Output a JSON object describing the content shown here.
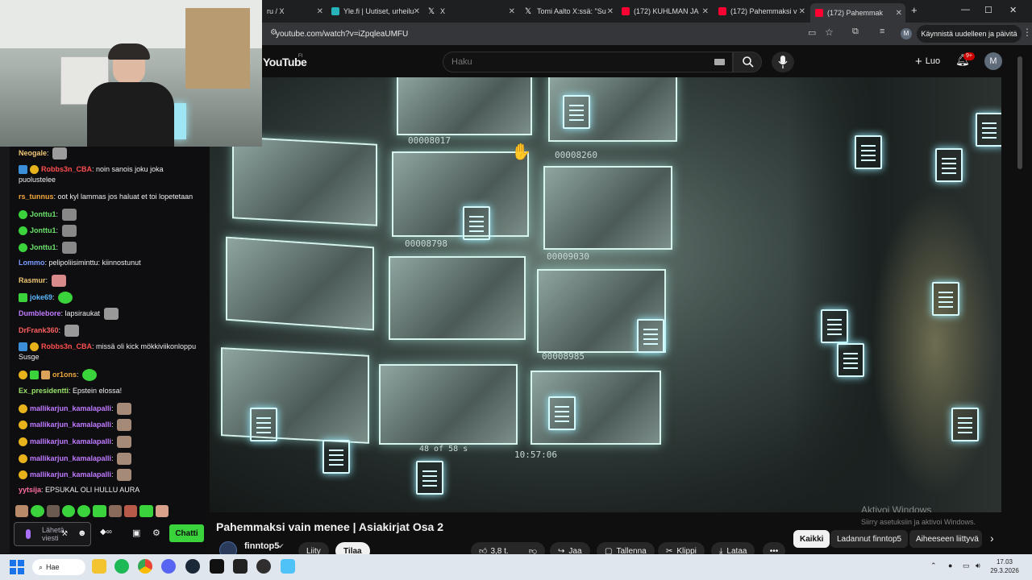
{
  "browser": {
    "tabs": [
      {
        "label": "ru / X",
        "favicon": "x-icon"
      },
      {
        "label": "Yle.fi | Uutiset, urheilu",
        "favicon": "yle-icon"
      },
      {
        "label": "X",
        "favicon": "x-icon"
      },
      {
        "label": "Tomi Aalto X:ssä: \"Su",
        "favicon": "x-icon"
      },
      {
        "label": "(172) KUHLMAN JA",
        "favicon": "youtube-icon"
      },
      {
        "label": "(172) Pahemmaksi v",
        "favicon": "youtube-icon"
      },
      {
        "label": "(172) Pahemmak",
        "favicon": "youtube-icon"
      }
    ],
    "url": "youtube.com/watch?v=iZpqleaUMFU",
    "restart_label": "Käynnistä uudelleen ja päivitä",
    "profile_initial": "M"
  },
  "youtube": {
    "logo": "YouTube",
    "region": "FI",
    "search_placeholder": "Haku",
    "create_label": "Luo",
    "notifications_badge": "9+",
    "avatar_initial": "M",
    "video_title": "Pahemmaksi vain menee | Asiakirjat Osa 2",
    "channel_name": "finntop5",
    "join_label": "Liity",
    "subscribe_label": "Tilaa",
    "like_count": "3,8 t.",
    "share_label": "Jaa",
    "save_label": "Tallenna",
    "clip_label": "Klippi",
    "download_label": "Lataa",
    "chips": [
      "Kaikki",
      "Ladannut finntop5",
      "Aiheeseen liittyvä"
    ],
    "video_text": {
      "codes": [
        "00008017",
        "00008260",
        "00008798",
        "00009030",
        "00008985"
      ],
      "counter": "48 of 58 s",
      "timestamp": "10:57:06"
    },
    "windows_watermark_title": "Aktivoi Windows",
    "windows_watermark_sub": "Siirry asetuksiin ja aktivoi Windows."
  },
  "chat": {
    "messages": [
      {
        "user": "Neogale",
        "text": "",
        "color": "#f0c674"
      },
      {
        "user": "Robbs3n_CBA",
        "text": "noin sanois joku joka puolustelee",
        "color": "#ff4f4f"
      },
      {
        "user": "rs_tunnus",
        "text": "oot kyl lammas jos haluat et toi lopetetaan",
        "color": "#f2a93b"
      },
      {
        "user": "Jonttu1",
        "text": "",
        "color": "#6ae36a"
      },
      {
        "user": "Jonttu1",
        "text": "",
        "color": "#6ae36a"
      },
      {
        "user": "Jonttu1",
        "text": "",
        "color": "#6ae36a"
      },
      {
        "user": "Lommo",
        "text": "pelipoliisiminttu: kiinnostunut",
        "color": "#7a9cff"
      },
      {
        "user": "Rasmur",
        "text": "",
        "color": "#f0c674"
      },
      {
        "user": "joke69",
        "text": "",
        "color": "#5ab7ff"
      },
      {
        "user": "Dumblebore",
        "text": "lapsiraukat",
        "color": "#c07aff"
      },
      {
        "user": "DrFrank360",
        "text": "",
        "color": "#ff5f5f"
      },
      {
        "user": "Robbs3n_CBA",
        "text": "missä oli kick mökkiviikonloppu Susge",
        "color": "#ff4f4f"
      },
      {
        "user": "or1ons",
        "text": "",
        "color": "#f2a93b"
      },
      {
        "user": "Ex_presidentti",
        "text": "Epstein elossa!",
        "color": "#9be36a"
      },
      {
        "user": "mallikarjun_kamalapalli",
        "text": "",
        "color": "#c07aff"
      },
      {
        "user": "mallikarjun_kamalapalli",
        "text": "",
        "color": "#c07aff"
      },
      {
        "user": "mallikarjun_kamalapalli",
        "text": "",
        "color": "#c07aff"
      },
      {
        "user": "mallikarjun_kamalapalli",
        "text": "",
        "color": "#c07aff"
      },
      {
        "user": "mallikarjun_kamalapalli",
        "text": "",
        "color": "#c07aff"
      },
      {
        "user": "yytsija",
        "text": "EPSUKAL OLI HULLU AURA",
        "color": "#ff6f9f"
      }
    ],
    "input_placeholder": "Lähetä viesti",
    "send_label": "Chatti"
  },
  "taskbar": {
    "search_label": "Hae",
    "time": "17.03",
    "date": "29.3.2026"
  },
  "colors": {
    "accent_red": "#ff0033",
    "chat_green": "#3ad33c",
    "glow": "#d5fbff"
  }
}
